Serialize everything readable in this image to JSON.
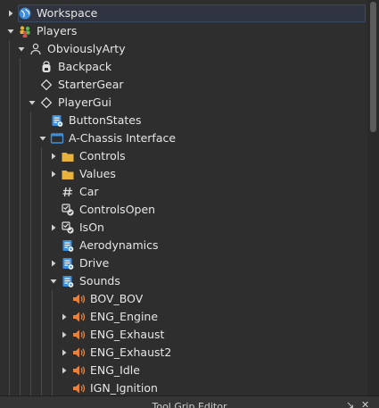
{
  "explorer": {
    "rows": [
      {
        "label": "Workspace",
        "icon": "globe-icon",
        "expander": "collapsed",
        "depth": 0,
        "selected": true,
        "name": "tree-item-workspace"
      },
      {
        "label": "Players",
        "icon": "players-icon",
        "expander": "expanded",
        "depth": 0,
        "name": "tree-item-players"
      },
      {
        "label": "ObviouslyArty",
        "icon": "player-icon",
        "expander": "expanded",
        "depth": 1,
        "name": "tree-item-obviouslyarty"
      },
      {
        "label": "Backpack",
        "icon": "backpack-icon",
        "expander": "none",
        "depth": 2,
        "name": "tree-item-backpack"
      },
      {
        "label": "StarterGear",
        "icon": "diamond-icon",
        "expander": "none",
        "depth": 2,
        "name": "tree-item-startergear"
      },
      {
        "label": "PlayerGui",
        "icon": "diamond-icon",
        "expander": "expanded",
        "depth": 2,
        "name": "tree-item-playergui"
      },
      {
        "label": "ButtonStates",
        "icon": "script-icon",
        "expander": "none",
        "depth": 3,
        "name": "tree-item-buttonstates"
      },
      {
        "label": "A-Chassis Interface",
        "icon": "screengui-icon",
        "expander": "expanded",
        "depth": 3,
        "name": "tree-item-a-chassis-interface"
      },
      {
        "label": "Controls",
        "icon": "folder-icon",
        "expander": "collapsed",
        "depth": 4,
        "name": "tree-item-controls"
      },
      {
        "label": "Values",
        "icon": "folder-icon",
        "expander": "collapsed",
        "depth": 4,
        "name": "tree-item-values"
      },
      {
        "label": "Car",
        "icon": "number-value-icon",
        "expander": "none",
        "depth": 4,
        "name": "tree-item-car"
      },
      {
        "label": "ControlsOpen",
        "icon": "bool-value-icon",
        "expander": "none",
        "depth": 4,
        "name": "tree-item-controlsopen"
      },
      {
        "label": "IsOn",
        "icon": "bool-value-icon",
        "expander": "collapsed",
        "depth": 4,
        "name": "tree-item-ison"
      },
      {
        "label": "Aerodynamics",
        "icon": "script-icon",
        "expander": "none",
        "depth": 4,
        "name": "tree-item-aerodynamics"
      },
      {
        "label": "Drive",
        "icon": "script-icon",
        "expander": "collapsed",
        "depth": 4,
        "name": "tree-item-drive"
      },
      {
        "label": "Sounds",
        "icon": "script-icon",
        "expander": "expanded",
        "depth": 4,
        "name": "tree-item-sounds"
      },
      {
        "label": "BOV_BOV",
        "icon": "sound-icon",
        "expander": "none",
        "depth": 5,
        "name": "tree-item-bov-bov"
      },
      {
        "label": "ENG_Engine",
        "icon": "sound-icon",
        "expander": "collapsed",
        "depth": 5,
        "name": "tree-item-eng-engine"
      },
      {
        "label": "ENG_Exhaust",
        "icon": "sound-icon",
        "expander": "collapsed",
        "depth": 5,
        "name": "tree-item-eng-exhaust"
      },
      {
        "label": "ENG_Exhaust2",
        "icon": "sound-icon",
        "expander": "collapsed",
        "depth": 5,
        "name": "tree-item-eng-exhaust2"
      },
      {
        "label": "ENG_Idle",
        "icon": "sound-icon",
        "expander": "collapsed",
        "depth": 5,
        "name": "tree-item-eng-idle"
      },
      {
        "label": "IGN_Ignition",
        "icon": "sound-icon",
        "expander": "none",
        "depth": 5,
        "name": "tree-item-ign-ignition"
      }
    ]
  },
  "bottom_panel": {
    "title": "Tool Grip Editor"
  }
}
